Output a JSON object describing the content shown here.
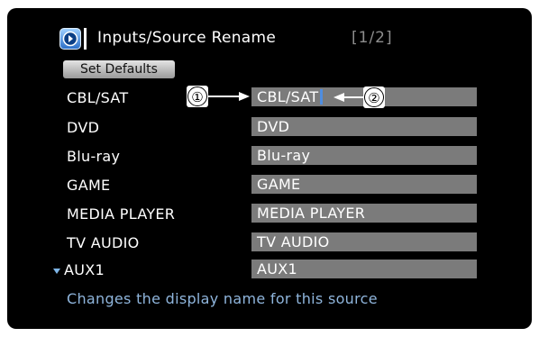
{
  "header": {
    "icon": "source-rename-icon",
    "title": "Inputs/Source Rename",
    "page_indicator": "[1/2]"
  },
  "set_defaults_label": "Set Defaults",
  "sources": [
    {
      "label": "CBL/SAT",
      "value": "CBL/SAT"
    },
    {
      "label": "DVD",
      "value": "DVD"
    },
    {
      "label": "Blu-ray",
      "value": "Blu-ray"
    },
    {
      "label": "GAME",
      "value": "GAME"
    },
    {
      "label": "MEDIA PLAYER",
      "value": "MEDIA PLAYER"
    },
    {
      "label": "TV AUDIO",
      "value": "TV AUDIO"
    },
    {
      "label": "AUX1",
      "value": "AUX1"
    }
  ],
  "selected_index": 6,
  "callouts": [
    "①",
    "②"
  ],
  "help_text": "Changes the display name for this source",
  "colors": {
    "screen_bg": "#000000",
    "field_bg": "#7b7b7b",
    "cursor": "#4f8de0",
    "help_text": "#8fb5dc",
    "page_indicator": "#8d8d8d"
  }
}
